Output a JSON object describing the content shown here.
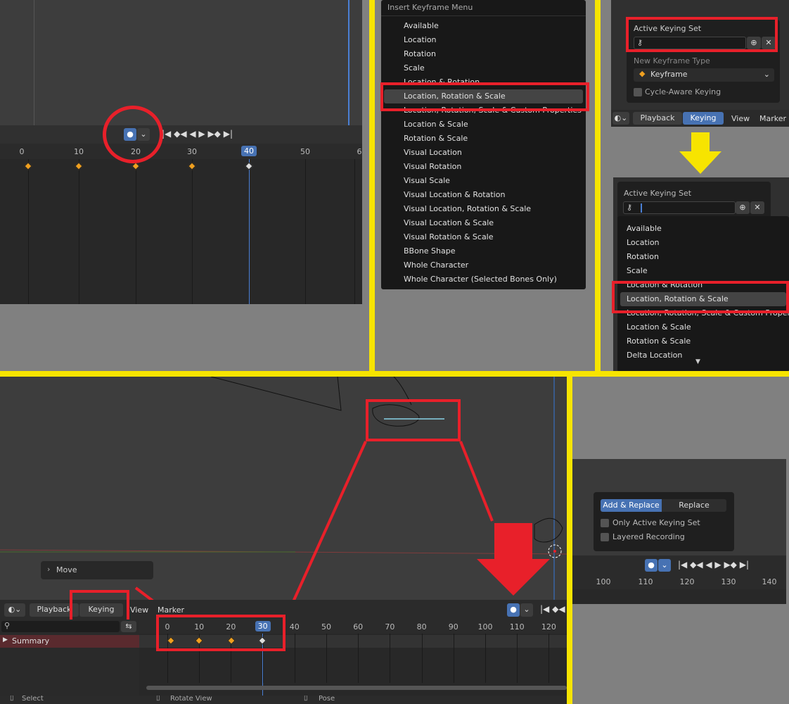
{
  "q1": {
    "ticks": [
      "0",
      "10",
      "20",
      "30",
      "40",
      "50",
      "6"
    ],
    "current_frame": "40"
  },
  "q2": {
    "title": "Insert Keyframe Menu",
    "items": [
      "Available",
      "Location",
      "Rotation",
      "Scale",
      "Location & Rotation",
      "Location, Rotation & Scale",
      "Location, Rotation, Scale & Custom Properties",
      "Location & Scale",
      "Rotation & Scale",
      "Visual Location",
      "Visual Rotation",
      "Visual Scale",
      "Visual Location & Rotation",
      "Visual Location, Rotation & Scale",
      "Visual Location & Scale",
      "Visual Rotation & Scale",
      "BBone Shape",
      "Whole Character",
      "Whole Character (Selected Bones Only)"
    ],
    "selected_index": 5
  },
  "q3": {
    "active_keying_set_label": "Active Keying Set",
    "new_keyframe_type_label": "New Keyframe Type",
    "keyframe_type_value": "Keyframe",
    "cycle_aware_label": "Cycle-Aware Keying",
    "header": [
      "Playback",
      "Keying",
      "View",
      "Marker"
    ]
  },
  "q4": {
    "active_keying_set_label": "Active Keying Set",
    "items": [
      "Available",
      "Location",
      "Rotation",
      "Scale",
      "Location & Rotation",
      "Location, Rotation & Scale",
      "Location, Rotation, Scale & Custom Properties",
      "Location & Scale",
      "Rotation & Scale",
      "Delta Location"
    ],
    "selected_index": 5
  },
  "q5": {
    "move_label": "Move",
    "header": [
      "Playback",
      "Keying",
      "View",
      "Marker"
    ],
    "summary_label": "Summary",
    "ticks": [
      "0",
      "10",
      "20",
      "30",
      "40",
      "50",
      "60",
      "70",
      "80",
      "90",
      "100",
      "110",
      "120"
    ],
    "current_frame": "30",
    "status": [
      "Select",
      "Rotate View",
      "Pose"
    ]
  },
  "q6": {
    "add_replace_label": "Add & Replace",
    "replace_label": "Replace",
    "only_active_label": "Only Active Keying Set",
    "layered_label": "Layered Recording",
    "ticks": [
      "100",
      "110",
      "120",
      "130",
      "140"
    ]
  },
  "colors": {
    "accent": "#4772b3",
    "highlight": "#e8202a",
    "divider": "#f7e400",
    "keyframe": "#f0a020"
  }
}
